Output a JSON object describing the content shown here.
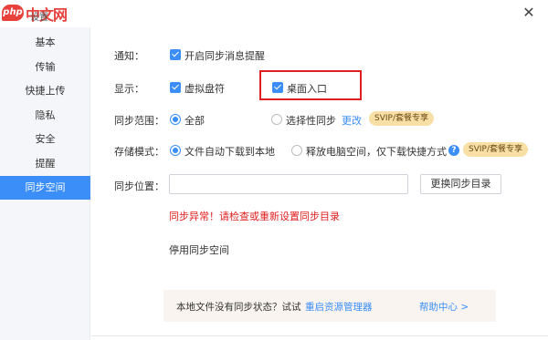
{
  "logo": {
    "badge": "php",
    "text": "中文网"
  },
  "window": {
    "title": "设置",
    "close_icon": "close-icon"
  },
  "sidebar": {
    "items": [
      {
        "label": "基本"
      },
      {
        "label": "传输"
      },
      {
        "label": "快捷上传"
      },
      {
        "label": "隐私"
      },
      {
        "label": "安全"
      },
      {
        "label": "提醒"
      },
      {
        "label": "同步空间",
        "active": true
      }
    ]
  },
  "notify": {
    "label": "通知：",
    "option": "开启同步消息提醒",
    "checked": true
  },
  "display": {
    "label": "显示：",
    "options": [
      {
        "label": "虚拟盘符",
        "checked": true
      },
      {
        "label": "桌面入口",
        "checked": true
      }
    ]
  },
  "sync_scope": {
    "label": "同步范围：",
    "options": [
      {
        "label": "全部",
        "selected": true
      },
      {
        "label": "选择性同步",
        "selected": false
      }
    ],
    "change_link": "更改",
    "badge": "SVIP/套餐专享"
  },
  "storage_mode": {
    "label": "存储模式：",
    "options": [
      {
        "label": "文件自动下载到本地",
        "selected": true
      },
      {
        "label": "释放电脑空间，仅下载快捷方式",
        "selected": false
      }
    ],
    "badge": "SVIP/套餐专享"
  },
  "sync_location": {
    "label": "同步位置：",
    "value": "",
    "button": "更换同步目录"
  },
  "error_message": "同步异常！请检查或重新设置同步目录",
  "stop_sync": "停用同步空间",
  "footer": {
    "text": "本地文件没有同步状态？试试",
    "link": "重启资源管理器",
    "help": "帮助中心 >"
  },
  "colors": {
    "accent": "#3b8ef8",
    "error": "#e02020",
    "highlight": "#e02020",
    "badge_bg": "#f7dfa6"
  }
}
